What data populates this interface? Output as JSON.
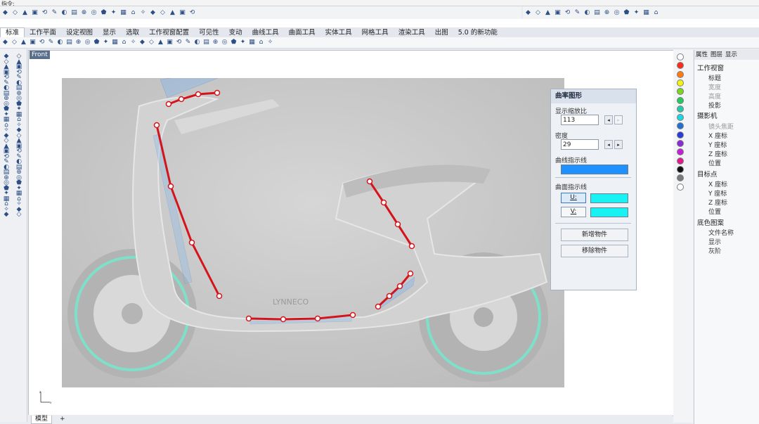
{
  "command_prompt": "指令:",
  "menu_tabs": [
    "标准",
    "工作平面",
    "设定视图",
    "显示",
    "选取",
    "工作视窗配置",
    "可见性",
    "变动",
    "曲线工具",
    "曲面工具",
    "实体工具",
    "网格工具",
    "渲染工具",
    "出图",
    "5.0 的新功能"
  ],
  "viewport": {
    "title": "Front",
    "bottom_tabs": [
      "模型",
      "+"
    ],
    "watermark_text": "LYNNECO"
  },
  "curvature_panel": {
    "title": "曲率图形",
    "scale_label": "显示缩放比",
    "scale_value": "113",
    "density_label": "密度",
    "density_value": "29",
    "curve_hair_label": "曲线指示线",
    "curve_hair_color": "#1e90ff",
    "surface_hair_label": "曲面指示线",
    "u_label": "U:",
    "v_label": "V:",
    "u_color": "#19f2f2",
    "v_color": "#19f2f2",
    "add_object_label": "新增物件",
    "remove_object_label": "移除物件"
  },
  "swatch_colors": [
    "#ffffff",
    "#ff2a1a",
    "#ff7a10",
    "#f3f312",
    "#7ad61e",
    "#26c95a",
    "#26c9a8",
    "#1cd6e4",
    "#1f6fd6",
    "#2b3ad8",
    "#8a2bd6",
    "#c21fd6",
    "#e01a8a",
    "#111111",
    "#7a7a7a",
    "#ffffff"
  ],
  "properties_panel": {
    "tabs": [
      "属性",
      "图层",
      "显示"
    ],
    "sections": {
      "viewport": "工作视窗",
      "camera": "摄影机",
      "target": "目标点",
      "wallpaper": "底色图案"
    },
    "viewport_rows": [
      "标题",
      "宽度",
      "高度",
      "投影"
    ],
    "camera_rows": [
      "镜头焦距",
      "X 座标",
      "Y 座标",
      "Z 座标",
      "位置"
    ],
    "target_rows": [
      "X 座标",
      "Y 座标",
      "Z 座标",
      "位置"
    ],
    "wallpaper_rows": [
      "文件名称",
      "显示",
      "灰阶"
    ]
  }
}
